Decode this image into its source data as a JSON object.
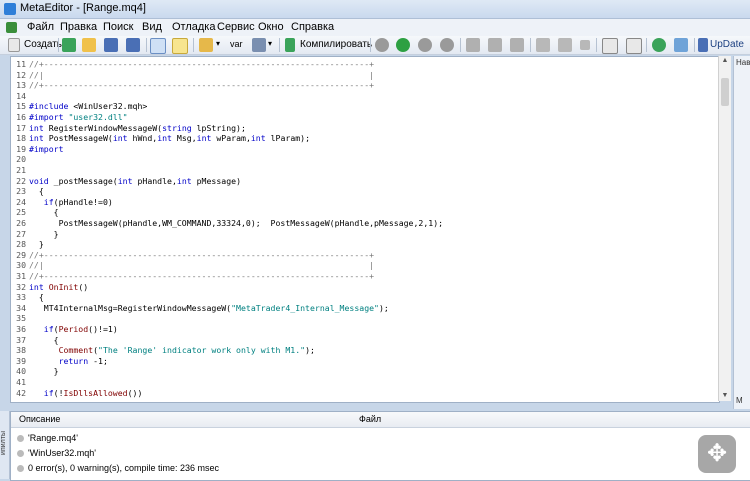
{
  "window": {
    "title": "MetaEditor - [Range.mq4]"
  },
  "menu": [
    "Файл",
    "Правка",
    "Поиск",
    "Вид",
    "Отладка",
    "Сервис",
    "Окно",
    "Справка"
  ],
  "toolbar": {
    "new_label": "Создать",
    "compile_label": "Компилировать",
    "var_label": "var",
    "update_label": "UpDate"
  },
  "navigator": {
    "header": "Нави",
    "tab": "M"
  },
  "lines": [
    {
      "n": "11",
      "t": "//+------------------------------------------------------------------+"
    },
    {
      "n": "12",
      "t": "//|                                                                  |"
    },
    {
      "n": "13",
      "t": "//+------------------------------------------------------------------+"
    },
    {
      "n": "14",
      "t": ""
    },
    {
      "n": "15",
      "t": "#include <WinUser32.mqh>"
    },
    {
      "n": "16",
      "t": "#import \"user32.dll\""
    },
    {
      "n": "17",
      "t": "int RegisterWindowMessageW(string lpString);"
    },
    {
      "n": "18",
      "t": "int PostMessageW(int hWnd,int Msg,int wParam,int lParam);"
    },
    {
      "n": "19",
      "t": "#import"
    },
    {
      "n": "20",
      "t": ""
    },
    {
      "n": "21",
      "t": ""
    },
    {
      "n": "22",
      "t": "void _postMessage(int pHandle,int pMessage)"
    },
    {
      "n": "23",
      "t": "  {"
    },
    {
      "n": "24",
      "t": "   if(pHandle!=0)"
    },
    {
      "n": "25",
      "t": "     {"
    },
    {
      "n": "26",
      "t": "      PostMessageW(pHandle,WM_COMMAND,33324,0);  PostMessageW(pHandle,pMessage,2,1);"
    },
    {
      "n": "27",
      "t": "     }"
    },
    {
      "n": "28",
      "t": "  }"
    },
    {
      "n": "29",
      "t": "//+------------------------------------------------------------------+"
    },
    {
      "n": "30",
      "t": "//|                                                                  |"
    },
    {
      "n": "31",
      "t": "//+------------------------------------------------------------------+"
    },
    {
      "n": "32",
      "t": "int OnInit()"
    },
    {
      "n": "33",
      "t": "  {"
    },
    {
      "n": "34",
      "t": "   MT4InternalMsg=RegisterWindowMessageW(\"MetaTrader4_Internal_Message\");"
    },
    {
      "n": "35",
      "t": ""
    },
    {
      "n": "36",
      "t": "   if(Period()!=1)"
    },
    {
      "n": "37",
      "t": "     {"
    },
    {
      "n": "38",
      "t": "      Comment(\"The 'Range' indicator work only with M1.\");"
    },
    {
      "n": "39",
      "t": "      return -1;"
    },
    {
      "n": "40",
      "t": "     }"
    },
    {
      "n": "41",
      "t": ""
    },
    {
      "n": "42",
      "t": "   if(!IsDllsAllowed())"
    }
  ],
  "output": {
    "col_desc": "Описание",
    "col_file": "Файл",
    "rows": [
      "'Range.mq4'",
      "'WinUser32.mqh'",
      "0 error(s), 0 warning(s), compile time: 236 msec"
    ],
    "side_tab": "ипилты"
  },
  "colors": {
    "keyword": "#0000c8",
    "comment": "#777777",
    "string": "#008080"
  }
}
